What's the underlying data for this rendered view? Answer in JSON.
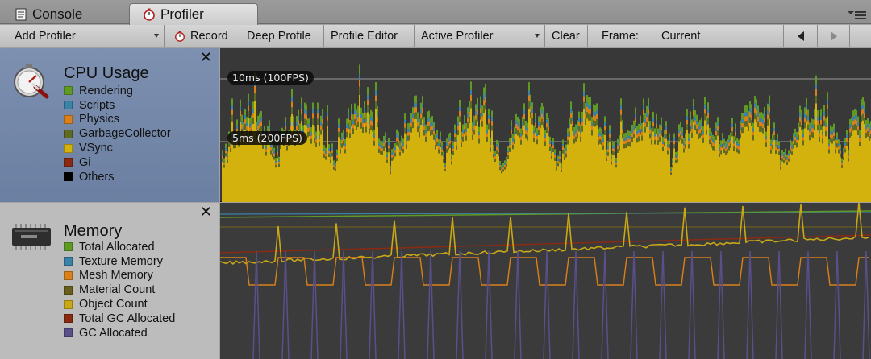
{
  "tabs": [
    {
      "label": "Console",
      "icon": "console-icon",
      "active": false
    },
    {
      "label": "Profiler",
      "icon": "stopwatch-icon",
      "active": true
    }
  ],
  "toolbar": {
    "add_profiler": "Add Profiler",
    "record": "Record",
    "deep_profile": "Deep Profile",
    "profile_editor": "Profile Editor",
    "active_profiler": "Active Profiler",
    "clear": "Clear",
    "frame_label": "Frame:",
    "frame_value": "Current"
  },
  "cpu": {
    "title": "CPU Usage",
    "legend": [
      {
        "label": "Rendering",
        "color": "#5f9a25"
      },
      {
        "label": "Scripts",
        "color": "#3a82a8"
      },
      {
        "label": "Physics",
        "color": "#d9801a"
      },
      {
        "label": "GarbageCollector",
        "color": "#5f6a22"
      },
      {
        "label": "VSync",
        "color": "#d4b20e"
      },
      {
        "label": "Gi",
        "color": "#8a2a12"
      },
      {
        "label": "Others",
        "color": "#000000"
      }
    ],
    "markers": [
      {
        "label": "10ms (100FPS)"
      },
      {
        "label": "5ms (200FPS)"
      }
    ]
  },
  "memory": {
    "title": "Memory",
    "legend": [
      {
        "label": "Total Allocated",
        "color": "#5f9a25"
      },
      {
        "label": "Texture Memory",
        "color": "#3a82a8"
      },
      {
        "label": "Mesh Memory",
        "color": "#d9801a"
      },
      {
        "label": "Material Count",
        "color": "#6a5e1c"
      },
      {
        "label": "Object Count",
        "color": "#c9a818"
      },
      {
        "label": "Total GC Allocated",
        "color": "#8a2a12"
      },
      {
        "label": "GC Allocated",
        "color": "#5a4f8a"
      }
    ]
  }
}
